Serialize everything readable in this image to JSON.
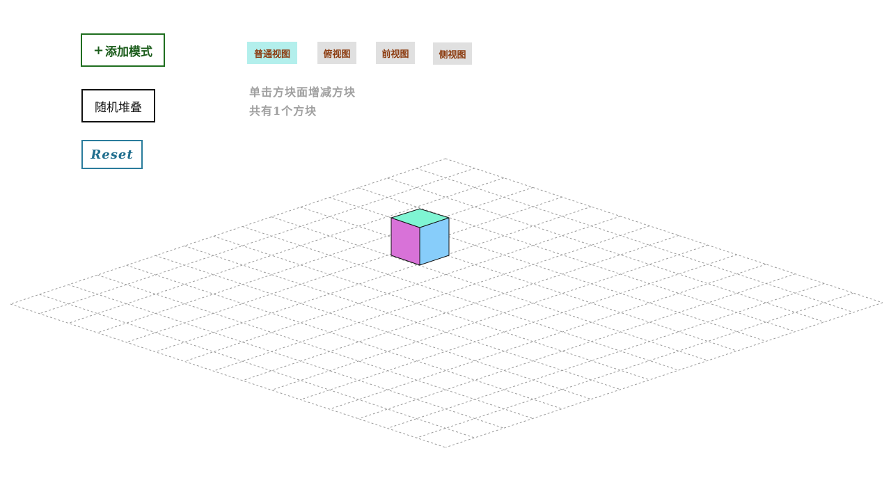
{
  "toolbar": {
    "add_mode_icon": "+",
    "add_mode_label": "添加模式",
    "random_stack_label": "随机堆叠",
    "reset_label": "Reset"
  },
  "view_tabs": [
    {
      "label": "普通视图",
      "active": true
    },
    {
      "label": "俯视图",
      "active": false
    },
    {
      "label": "前视图",
      "active": false
    },
    {
      "label": "侧视图",
      "active": false
    }
  ],
  "hints": {
    "instruction": "单击方块面增减方块",
    "count_text": "共有1个方块"
  },
  "scene": {
    "grid_cells": 15,
    "cube_count": 1,
    "cube_colors": {
      "top": "#7ff5d3",
      "left": "#d872d8",
      "right": "#87cdfa"
    },
    "grid_color": "#9a9a9a"
  }
}
